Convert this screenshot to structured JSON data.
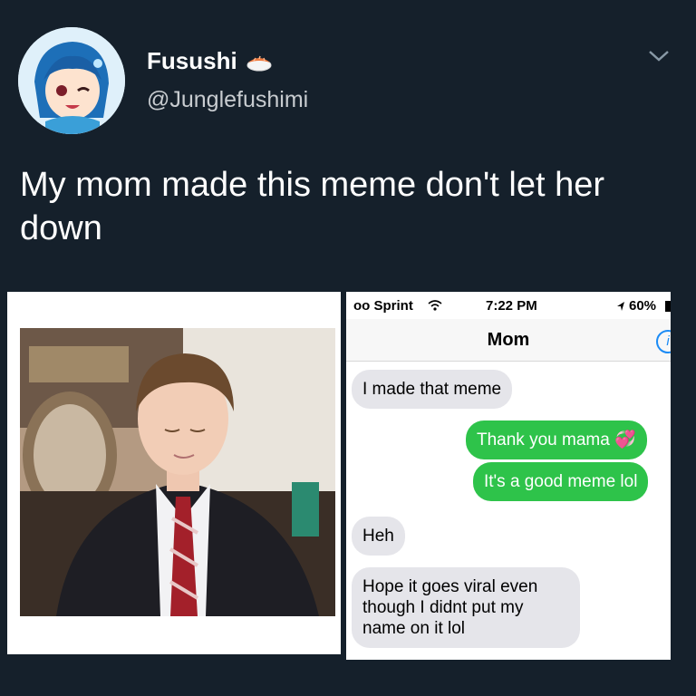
{
  "tweet": {
    "display_name": "Fusushi",
    "handle": "@Junglefushimi",
    "text": "My mom made this meme don't let her down"
  },
  "phone": {
    "carrier": "oo Sprint",
    "time": "7:22 PM",
    "battery": "60%",
    "contact": "Mom",
    "messages": [
      {
        "from": "mom",
        "text": "I made that meme"
      },
      {
        "from": "me",
        "text": "Thank you mama 💞"
      },
      {
        "from": "me",
        "text": "It's a good meme lol"
      },
      {
        "from": "mom",
        "text": "Heh"
      },
      {
        "from": "mom",
        "text": "Hope it goes viral even though I didnt put my name on it lol"
      }
    ]
  },
  "colors": {
    "background": "#15202b",
    "incoming_bubble": "#e5e5ea",
    "outgoing_bubble": "#2ec34a",
    "ios_blue": "#1b8bf5"
  },
  "icons": [
    "avatar-anime-girl",
    "sushi-emoji",
    "chevron-down-icon",
    "wifi-icon",
    "location-arrow-icon",
    "battery-icon",
    "info-icon"
  ]
}
